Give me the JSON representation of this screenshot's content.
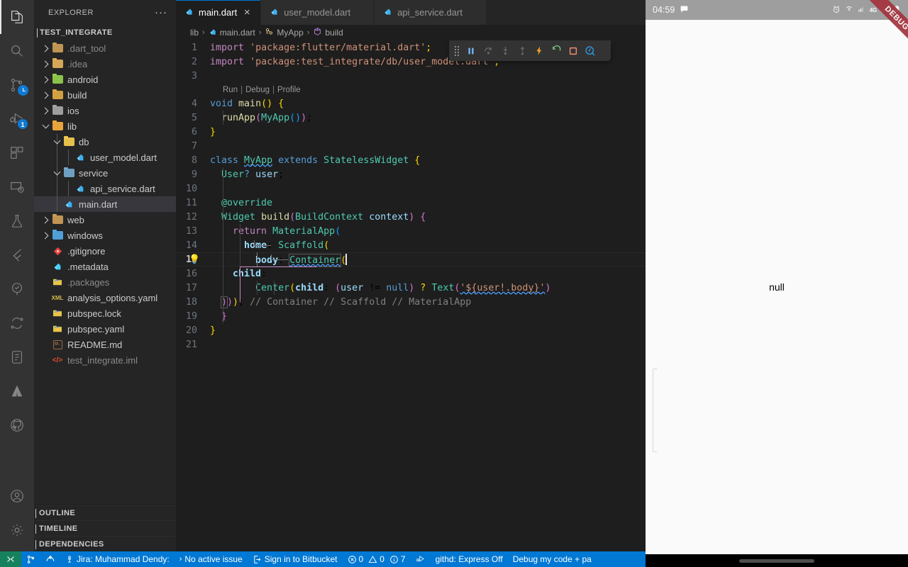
{
  "activitybar": {
    "items": [
      {
        "name": "explorer",
        "icon": "files-icon",
        "active": true,
        "badge": null
      },
      {
        "name": "search",
        "icon": "search-icon",
        "active": false,
        "badge": null
      },
      {
        "name": "source-control",
        "icon": "source-control-icon",
        "active": false,
        "badge": "clock"
      },
      {
        "name": "run-and-debug",
        "icon": "run-debug-icon",
        "active": false,
        "badge": "1"
      },
      {
        "name": "extensions",
        "icon": "extensions-icon",
        "active": false,
        "badge": null
      },
      {
        "name": "remote-explorer",
        "icon": "remote-explorer-icon",
        "active": false,
        "badge": null
      },
      {
        "name": "testing",
        "icon": "beaker-icon",
        "active": false,
        "badge": null
      },
      {
        "name": "flutter",
        "icon": "flutter-icon",
        "active": false,
        "badge": null
      },
      {
        "name": "todo-tree",
        "icon": "tree-icon",
        "active": false,
        "badge": null
      },
      {
        "name": "diff",
        "icon": "diff-icon",
        "active": false,
        "badge": null
      },
      {
        "name": "notes",
        "icon": "notes-icon",
        "active": false,
        "badge": null
      },
      {
        "name": "atlassian",
        "icon": "atlassian-icon",
        "active": false,
        "badge": null
      },
      {
        "name": "github",
        "icon": "github-icon",
        "active": false,
        "badge": null
      }
    ],
    "bottom": [
      {
        "name": "accounts",
        "icon": "account-icon"
      },
      {
        "name": "settings",
        "icon": "gear-icon"
      }
    ]
  },
  "sidebar": {
    "title": "EXPLORER",
    "more_label": "···",
    "root": "TEST_INTEGRATE",
    "tree": [
      {
        "label": ".dart_tool",
        "depth": 1,
        "type": "folder",
        "state": "collapsed",
        "color": "#c09553",
        "selected": false,
        "dim": true
      },
      {
        "label": ".idea",
        "depth": 1,
        "type": "folder",
        "state": "collapsed",
        "color": "#d8a657",
        "selected": false,
        "dim": true
      },
      {
        "label": "android",
        "depth": 1,
        "type": "folder",
        "state": "collapsed",
        "color": "#8bc34a",
        "selected": false,
        "dim": false
      },
      {
        "label": "build",
        "depth": 1,
        "type": "folder",
        "state": "collapsed",
        "color": "#d3a041",
        "selected": false,
        "dim": false
      },
      {
        "label": "ios",
        "depth": 1,
        "type": "folder",
        "state": "collapsed",
        "color": "#9e9e9e",
        "selected": false,
        "dim": false
      },
      {
        "label": "lib",
        "depth": 1,
        "type": "folder",
        "state": "expanded",
        "color": "#e8a33d",
        "selected": false,
        "dim": false
      },
      {
        "label": "db",
        "depth": 2,
        "type": "folder",
        "state": "expanded",
        "color": "#e5c04b",
        "selected": false,
        "dim": false
      },
      {
        "label": "user_model.dart",
        "depth": 3,
        "type": "dart",
        "state": "none",
        "color": "#3db0f0",
        "selected": false,
        "dim": false
      },
      {
        "label": "service",
        "depth": 2,
        "type": "folder",
        "state": "expanded",
        "color": "#6f9fc0",
        "selected": false,
        "dim": false
      },
      {
        "label": "api_service.dart",
        "depth": 3,
        "type": "dart",
        "state": "none",
        "color": "#3db0f0",
        "selected": false,
        "dim": false
      },
      {
        "label": "main.dart",
        "depth": 2,
        "type": "dart",
        "state": "none",
        "color": "#3db0f0",
        "selected": true,
        "dim": false
      },
      {
        "label": "web",
        "depth": 1,
        "type": "folder",
        "state": "collapsed",
        "color": "#c09553",
        "selected": false,
        "dim": false
      },
      {
        "label": "windows",
        "depth": 1,
        "type": "folder",
        "state": "collapsed",
        "color": "#4f9fd8",
        "selected": false,
        "dim": false
      },
      {
        "label": ".gitignore",
        "depth": 1,
        "type": "git",
        "state": "none",
        "color": "#e8443a",
        "selected": false,
        "dim": false
      },
      {
        "label": ".metadata",
        "depth": 1,
        "type": "flutter",
        "state": "none",
        "color": "#45d1fd",
        "selected": false,
        "dim": false
      },
      {
        "label": ".packages",
        "depth": 1,
        "type": "yaml",
        "state": "none",
        "color": "#e8c547",
        "selected": false,
        "dim": true
      },
      {
        "label": "analysis_options.yaml",
        "depth": 1,
        "type": "xml",
        "state": "none",
        "color": "#d2b94b",
        "selected": false,
        "dim": false
      },
      {
        "label": "pubspec.lock",
        "depth": 1,
        "type": "yaml",
        "state": "none",
        "color": "#e8c547",
        "selected": false,
        "dim": false
      },
      {
        "label": "pubspec.yaml",
        "depth": 1,
        "type": "yaml",
        "state": "none",
        "color": "#e8c547",
        "selected": false,
        "dim": false
      },
      {
        "label": "README.md",
        "depth": 1,
        "type": "md",
        "state": "none",
        "color": "#9b6b43",
        "selected": false,
        "dim": false
      },
      {
        "label": "test_integrate.iml",
        "depth": 1,
        "type": "code",
        "state": "none",
        "color": "#e8512a",
        "selected": false,
        "dim": true
      }
    ],
    "bottom_sections": [
      {
        "label": "OUTLINE"
      },
      {
        "label": "TIMELINE"
      },
      {
        "label": "DEPENDENCIES"
      }
    ]
  },
  "editor": {
    "tabs": [
      {
        "label": "main.dart",
        "active": true,
        "icon": "dart-file-icon"
      },
      {
        "label": "user_model.dart",
        "active": false,
        "icon": "dart-file-icon"
      },
      {
        "label": "api_service.dart",
        "active": false,
        "icon": "dart-file-icon"
      }
    ],
    "tab_close_label": "×",
    "tab_actions": [
      {
        "name": "run-or-debug",
        "icon": "run-debug-icon"
      },
      {
        "name": "run-dropdown",
        "icon": "chevron-down-icon"
      },
      {
        "name": "timeline-history",
        "icon": "history-icon"
      },
      {
        "name": "hot-reload",
        "icon": "hot-reload-icon"
      },
      {
        "name": "split-editor",
        "icon": "split-editor-icon"
      },
      {
        "name": "more-actions",
        "icon": "ellipsis-icon"
      }
    ],
    "breadcrumbs": [
      {
        "label": "lib",
        "icon": "none"
      },
      {
        "label": "main.dart",
        "icon": "dart-file-icon"
      },
      {
        "label": "MyApp",
        "icon": "class-icon"
      },
      {
        "label": "build",
        "icon": "method-icon"
      }
    ],
    "breadcrumb_separator": "›",
    "codelens": {
      "run": "Run",
      "debug": "Debug",
      "profile": "Profile",
      "separator": "|"
    },
    "lines": [
      {
        "n": "1",
        "cur": false
      },
      {
        "n": "2",
        "cur": false
      },
      {
        "n": "3",
        "cur": false
      },
      {
        "n": "4",
        "cur": false
      },
      {
        "n": "5",
        "cur": false
      },
      {
        "n": "6",
        "cur": false
      },
      {
        "n": "7",
        "cur": false
      },
      {
        "n": "8",
        "cur": false
      },
      {
        "n": "9",
        "cur": false
      },
      {
        "n": "10",
        "cur": false
      },
      {
        "n": "11",
        "cur": false
      },
      {
        "n": "12",
        "cur": false
      },
      {
        "n": "13",
        "cur": false
      },
      {
        "n": "14",
        "cur": false
      },
      {
        "n": "15",
        "cur": true
      },
      {
        "n": "16",
        "cur": false
      },
      {
        "n": "17",
        "cur": false
      },
      {
        "n": "18",
        "cur": false
      },
      {
        "n": "19",
        "cur": false
      },
      {
        "n": "20",
        "cur": false
      },
      {
        "n": "21",
        "cur": false
      }
    ],
    "source_text": [
      "import 'package:flutter/material.dart';",
      "import 'package:test_integrate/db/user_model.dart';",
      "",
      "void main() {",
      "  runApp(MyApp());",
      "}",
      "",
      "class MyApp extends StatelessWidget {",
      "  User? user;",
      "",
      "  @override",
      "  Widget build(BuildContext context) {",
      "    return MaterialApp(",
      "      home: Scaffold(",
      "        body: Container(",
      "    child:",
      "        Center(child: (user != null) ? Text('${user!.body}')",
      "  )); // Container // Scaffold // MaterialApp",
      "  }",
      "}",
      ""
    ],
    "lightbulb_line": "15",
    "lightbulb_glyph": "💡"
  },
  "debug_toolbar": {
    "buttons": [
      {
        "name": "drag-handle",
        "icon": "gripper-icon",
        "label": ""
      },
      {
        "name": "pause",
        "icon": "pause-icon",
        "label": ""
      },
      {
        "name": "step-over",
        "icon": "step-over-icon",
        "label": ""
      },
      {
        "name": "step-into",
        "icon": "step-into-icon",
        "label": ""
      },
      {
        "name": "step-out",
        "icon": "step-out-icon",
        "label": ""
      },
      {
        "name": "hot-reload",
        "icon": "lightning-icon",
        "label": ""
      },
      {
        "name": "hot-restart",
        "icon": "restart-icon",
        "label": ""
      },
      {
        "name": "stop",
        "icon": "stop-icon",
        "label": ""
      },
      {
        "name": "open-devtools",
        "icon": "devtools-icon",
        "label": ""
      }
    ]
  },
  "emulator": {
    "clock": "04:59",
    "status_icons": [
      "message-icon",
      "alarm-icon",
      "wifi-icon",
      "signal-icon",
      "4g-icon",
      "signal2-icon",
      "battery-icon"
    ],
    "network_label": "4G",
    "debug_banner": "DEBUG",
    "content": "null"
  },
  "statusbar": {
    "remote_label": "",
    "left": [
      {
        "name": "remote-window",
        "icon": "remote-icon",
        "label": ""
      },
      {
        "name": "source-branch",
        "icon": "branch-icon",
        "label": ""
      },
      {
        "name": "sync-changes",
        "icon": "sync-icon",
        "label": ""
      },
      {
        "name": "jira-account",
        "icon": "person-icon",
        "label": "Jira: Muhammad Dendy:"
      },
      {
        "name": "active-issue",
        "icon": "chevron-right-icon",
        "label": "No active issue"
      },
      {
        "name": "bitbucket",
        "icon": "bitbucket-icon",
        "label": "Sign in to Bitbucket"
      },
      {
        "name": "problems",
        "icon": "problems-icon",
        "label": ""
      }
    ],
    "problems": {
      "errors": "0",
      "warnings": "0",
      "infos": "7"
    },
    "right": [
      {
        "name": "debug-console-extra",
        "icon": "debug-icon",
        "label": ""
      },
      {
        "name": "githd-express",
        "icon": "none",
        "label": "githd: Express Off"
      },
      {
        "name": "debug-my-code",
        "icon": "none",
        "label": "Debug my code + pa"
      }
    ]
  },
  "colors": {
    "accent_blue": "#0078d4",
    "remote_green": "#16825d",
    "tab_active_bg": "#1e1e1e",
    "sidebar_bg": "#252526",
    "activitybar_bg": "#333333",
    "editor_bg": "#1e1e1e",
    "debug_ribbon": "#a3333d"
  }
}
